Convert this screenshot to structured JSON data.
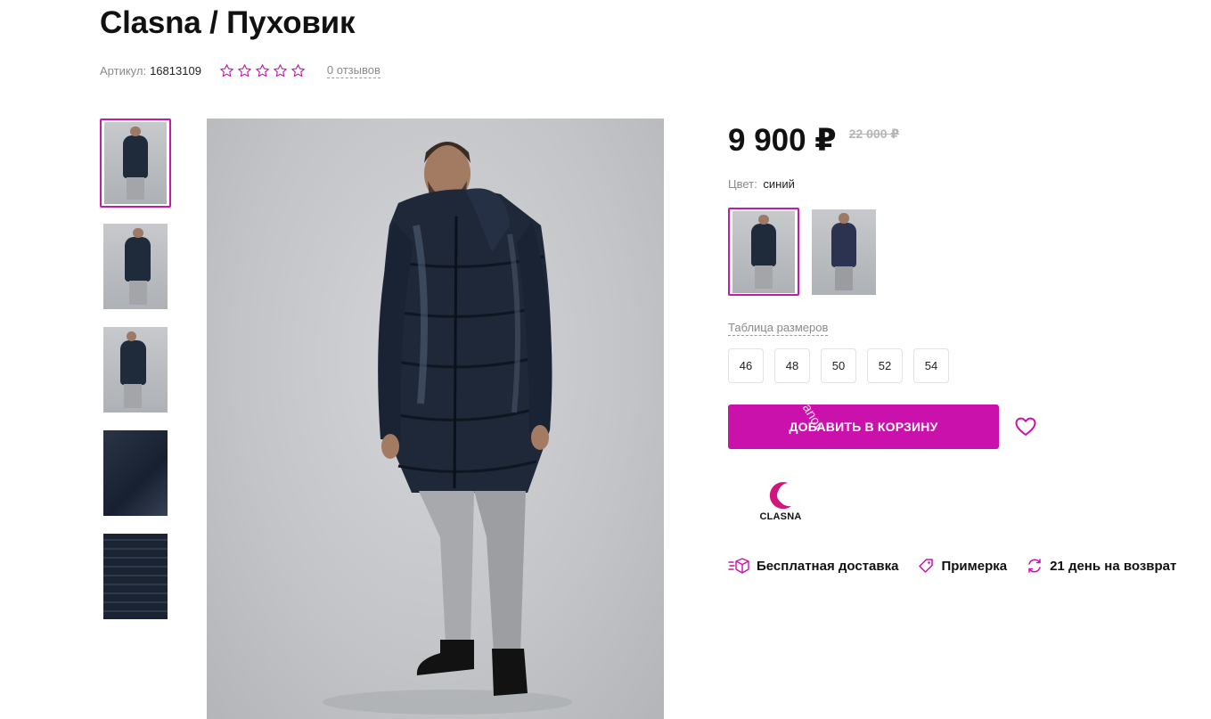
{
  "product": {
    "title": "Clasna / Пуховик",
    "article_label": "Артикул:",
    "article_value": "16813109",
    "rating_stars": 0,
    "reviews_label": "0 отзывов"
  },
  "price": {
    "current": "9 900 ₽",
    "old": "22 000 ₽"
  },
  "color": {
    "label": "Цвет:",
    "value": "синий"
  },
  "size_table_label": "Таблица размеров",
  "sizes": [
    "46",
    "48",
    "50",
    "52",
    "54"
  ],
  "cart_button_label": "ДОБАВИТЬ В КОРЗИНУ",
  "watermark_text": "kovanov",
  "brand": {
    "logo_text": "CLASNA"
  },
  "features": [
    {
      "icon": "delivery-box-icon",
      "label": "Бесплатная доставка"
    },
    {
      "icon": "price-tag-icon",
      "label": "Примерка"
    },
    {
      "icon": "return-arrows-icon",
      "label": "21 день на возврат"
    }
  ],
  "colors": {
    "accent": "#cb11ab",
    "active_border": "#c41ab0",
    "muted_text": "#8a8a8a",
    "old_price": "#b5b5b5"
  }
}
